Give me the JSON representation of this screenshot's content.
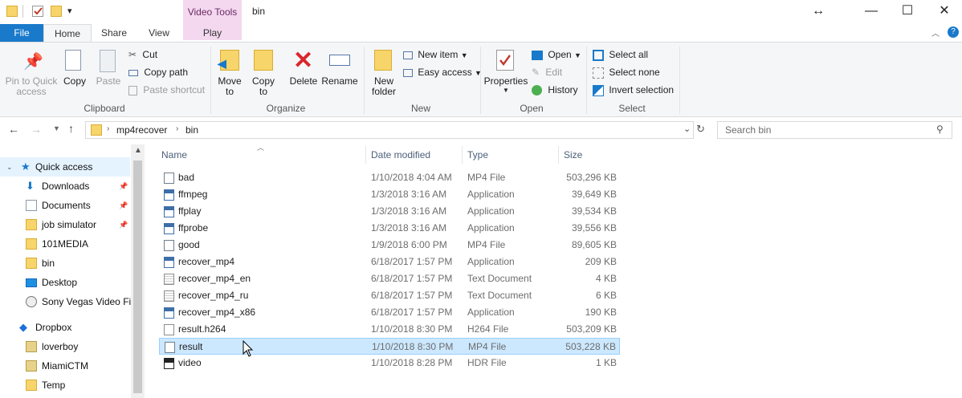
{
  "window": {
    "title": "bin",
    "context_tab_group": "Video Tools",
    "controls": {
      "resize": "↔",
      "minimize": "—",
      "maximize": "☐",
      "close": "✕"
    }
  },
  "tabs": {
    "file": "File",
    "home": "Home",
    "share": "Share",
    "view": "View",
    "play": "Play"
  },
  "ribbon": {
    "clipboard": {
      "name": "Clipboard",
      "pin": "Pin to Quick\naccess",
      "copy": "Copy",
      "paste": "Paste",
      "cut": "Cut",
      "copy_path": "Copy path",
      "paste_shortcut": "Paste shortcut"
    },
    "organize": {
      "name": "Organize",
      "move_to": "Move\nto",
      "copy_to": "Copy\nto",
      "delete": "Delete",
      "rename": "Rename"
    },
    "new": {
      "name": "New",
      "new_folder": "New\nfolder",
      "new_item": "New item",
      "easy_access": "Easy access"
    },
    "open": {
      "name": "Open",
      "properties": "Properties",
      "open": "Open",
      "edit": "Edit",
      "history": "History"
    },
    "select": {
      "name": "Select",
      "select_all": "Select all",
      "select_none": "Select none",
      "invert": "Invert selection"
    }
  },
  "address": {
    "crumbs": [
      "mp4recover",
      "bin"
    ],
    "search_placeholder": "Search bin"
  },
  "nav": {
    "quick_access": "Quick access",
    "items": [
      "Downloads",
      "Documents",
      "job simulator",
      "101MEDIA",
      "bin",
      "Desktop",
      "Sony Vegas Video File"
    ],
    "dropbox": "Dropbox",
    "dropbox_items": [
      "loverboy",
      "MiamiCTM",
      "Temp"
    ]
  },
  "columns": {
    "name": "Name",
    "date": "Date modified",
    "type": "Type",
    "size": "Size"
  },
  "files": [
    {
      "name": "bad",
      "date": "1/10/2018 4:04 AM",
      "type": "MP4 File",
      "size": "503,296 KB",
      "icon": "video-file-icon"
    },
    {
      "name": "ffmpeg",
      "date": "1/3/2018 3:16 AM",
      "type": "Application",
      "size": "39,649 KB",
      "icon": "application-icon"
    },
    {
      "name": "ffplay",
      "date": "1/3/2018 3:16 AM",
      "type": "Application",
      "size": "39,534 KB",
      "icon": "application-icon"
    },
    {
      "name": "ffprobe",
      "date": "1/3/2018 3:16 AM",
      "type": "Application",
      "size": "39,556 KB",
      "icon": "application-icon"
    },
    {
      "name": "good",
      "date": "1/9/2018 6:00 PM",
      "type": "MP4 File",
      "size": "89,605 KB",
      "icon": "video-file-icon"
    },
    {
      "name": "recover_mp4",
      "date": "6/18/2017 1:57 PM",
      "type": "Application",
      "size": "209 KB",
      "icon": "application-icon"
    },
    {
      "name": "recover_mp4_en",
      "date": "6/18/2017 1:57 PM",
      "type": "Text Document",
      "size": "4 KB",
      "icon": "text-file-icon"
    },
    {
      "name": "recover_mp4_ru",
      "date": "6/18/2017 1:57 PM",
      "type": "Text Document",
      "size": "6 KB",
      "icon": "text-file-icon"
    },
    {
      "name": "recover_mp4_x86",
      "date": "6/18/2017 1:57 PM",
      "type": "Application",
      "size": "190 KB",
      "icon": "application-icon"
    },
    {
      "name": "result.h264",
      "date": "1/10/2018 8:30 PM",
      "type": "H264 File",
      "size": "503,209 KB",
      "icon": "generic-file-icon"
    },
    {
      "name": "result",
      "date": "1/10/2018 8:30 PM",
      "type": "MP4 File",
      "size": "503,228 KB",
      "icon": "video-file-icon"
    },
    {
      "name": "video",
      "date": "1/10/2018 8:28 PM",
      "type": "HDR File",
      "size": "1 KB",
      "icon": "hdr-file-icon"
    }
  ],
  "colors": {
    "file_tab": "#1979ca",
    "selection": "#cce8ff",
    "hover": "#e5f3ff",
    "video_tools": "#f3d8ef"
  }
}
